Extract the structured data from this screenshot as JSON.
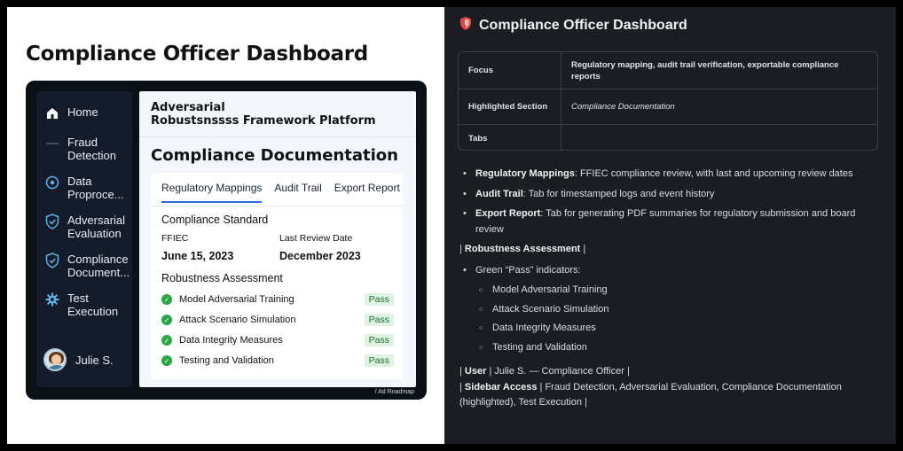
{
  "left": {
    "title": "Compliance Officer Dashboard",
    "sidebar": {
      "items": [
        {
          "label": "Home",
          "icon": "home-icon"
        },
        {
          "label": "Fraud\nDetection",
          "icon": "dash-icon"
        },
        {
          "label": "Data\nProproce...",
          "icon": "target-icon"
        },
        {
          "label": "Adversarial\nEvaluation",
          "icon": "shield-check-icon"
        },
        {
          "label": "Compliance\nDocument...",
          "icon": "shield-check-icon"
        },
        {
          "label": "Test\nExecution",
          "icon": "gear-icon"
        }
      ],
      "user_name": "Julie S."
    },
    "main": {
      "platform_name": "Adversarial\nRobustsnssss Framework Platform",
      "section_title": "Compliance Documentation",
      "tabs": [
        "Regulatory Mappings",
        "Audit Trail",
        "Export Report"
      ],
      "active_tab": 0,
      "compliance_standard_label": "Compliance Standard",
      "standard_name": "FFIEC",
      "standard_date": "June 15, 2023",
      "last_review_label": "Last Review Date",
      "last_review_date": "December 2023",
      "robustness_title": "Robustness Assessment",
      "checks": [
        {
          "name": "Model Adversarial Training",
          "status": "Pass"
        },
        {
          "name": "Attack Scenario Simulation",
          "status": "Pass"
        },
        {
          "name": "Data Integrity Measures",
          "status": "Pass"
        },
        {
          "name": "Testing and Validation",
          "status": "Pass"
        }
      ]
    },
    "footer_note": "/ Ad Roadmap"
  },
  "right": {
    "title": "Compliance Officer Dashboard",
    "table": [
      {
        "key": "Focus",
        "value": "Regulatory mapping, audit trail verification, exportable compliance reports"
      },
      {
        "key": "Highlighted Section",
        "value": "Compliance Documentation"
      },
      {
        "key": "Tabs",
        "value": ""
      }
    ],
    "bullets": [
      {
        "bold": "Regulatory Mappings",
        "text": ": FFIEC compliance review, with last and upcoming review dates"
      },
      {
        "bold": "Audit Trail",
        "text": ": Tab for timestamped logs and event history"
      },
      {
        "bold": "Export Report",
        "text": ": Tab for generating PDF summaries for regulatory submission and board review"
      }
    ],
    "robustness_header": "Robustness Assessment",
    "indicator_intro": "Green “Pass” indicators:",
    "indicators": [
      "Model Adversarial Training",
      "Attack Scenario Simulation",
      "Data Integrity Measures",
      "Testing and Validation"
    ],
    "user_label": "User",
    "user_value": "Julie S. — Compliance Officer",
    "sidebar_label": "Sidebar Access",
    "sidebar_value": "Fraud Detection, Adversarial Evaluation, Compliance Documentation (highlighted), Test Execution"
  },
  "colors": {
    "accent": "#2b6fd6",
    "pass_bg": "#dff3e3",
    "pass_text": "#1d6b2f",
    "check_green": "#28a745"
  }
}
